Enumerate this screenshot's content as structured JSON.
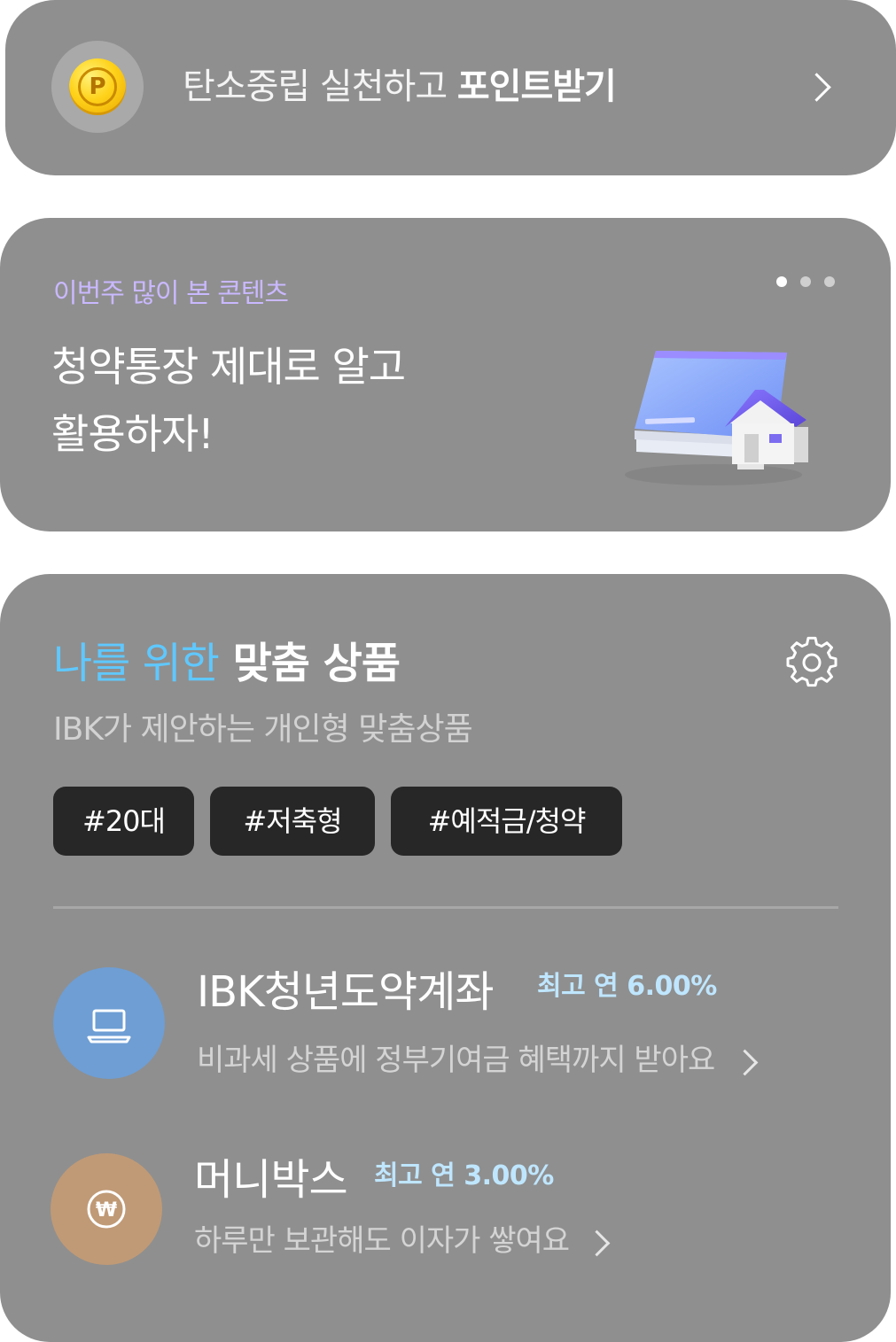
{
  "points_banner": {
    "text_regular": "탄소중립 실천하고 ",
    "text_bold": "포인트받기",
    "coin_letter": "P",
    "icons": [
      "coin-icon",
      "chevron-right-icon"
    ]
  },
  "content_card": {
    "kicker": "이번주 많이 본 콘텐츠",
    "title_line1": "청약통장 제대로 알고",
    "title_line2": "활용하자!",
    "carousel": {
      "pages": 3,
      "active_index": 0
    },
    "illustration": "passbook-house-illustration"
  },
  "recommendations": {
    "title_accent": "나를 위한",
    "title_strong": "맞춤 상품",
    "subtitle": "IBK가 제안하는 개인형 맞춤상품",
    "settings_icon": "gear-icon",
    "tags": [
      "#20대",
      "#저축형",
      "#예적금/청약"
    ],
    "products": [
      {
        "name": "IBK청년도약계좌",
        "rate": "최고 연 6.00%",
        "description": "비과세 상품에 정부기여금 혜택까지 받아요",
        "icon": "laptop-icon",
        "icon_bg": "#6e9ed4"
      },
      {
        "name": "머니박스",
        "rate": "최고 연 3.00%",
        "description": "하루만 보관해도 이자가 쌓여요",
        "icon": "won-coin-icon",
        "icon_bg": "#c09a76"
      }
    ]
  },
  "colors": {
    "card_bg": "#8f8f8f",
    "accent_blue": "#5fc8ff",
    "kicker_purple": "#c9b8ff",
    "tag_bg": "#272727",
    "rate_text": "#bfe6ff"
  }
}
